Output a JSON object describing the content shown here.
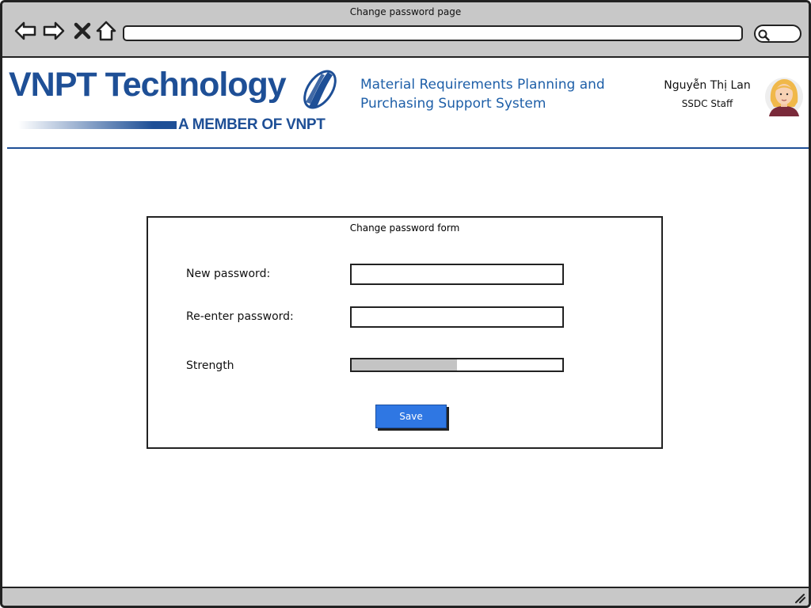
{
  "browser": {
    "page_title": "Change password page",
    "search_icon": "search-icon"
  },
  "header": {
    "logo_main": "VNPT Technology",
    "logo_sub": "A MEMBER OF VNPT",
    "system_title_line1": "Material Requirements Planning and",
    "system_title_line2": "Purchasing Support System",
    "user_name": "Nguyễn Thị Lan",
    "user_role": "SSDC Staff"
  },
  "form": {
    "title": "Change password form",
    "new_password_label": "New password:",
    "new_password_value": "",
    "reenter_password_label": "Re-enter password:",
    "reenter_password_value": "",
    "strength_label": "Strength",
    "strength_level": 0.5,
    "save_label": "Save"
  },
  "colors": {
    "brand_blue": "#1e4f96",
    "save_button": "#2f77e3",
    "chrome_gray": "#c8c8c8"
  }
}
